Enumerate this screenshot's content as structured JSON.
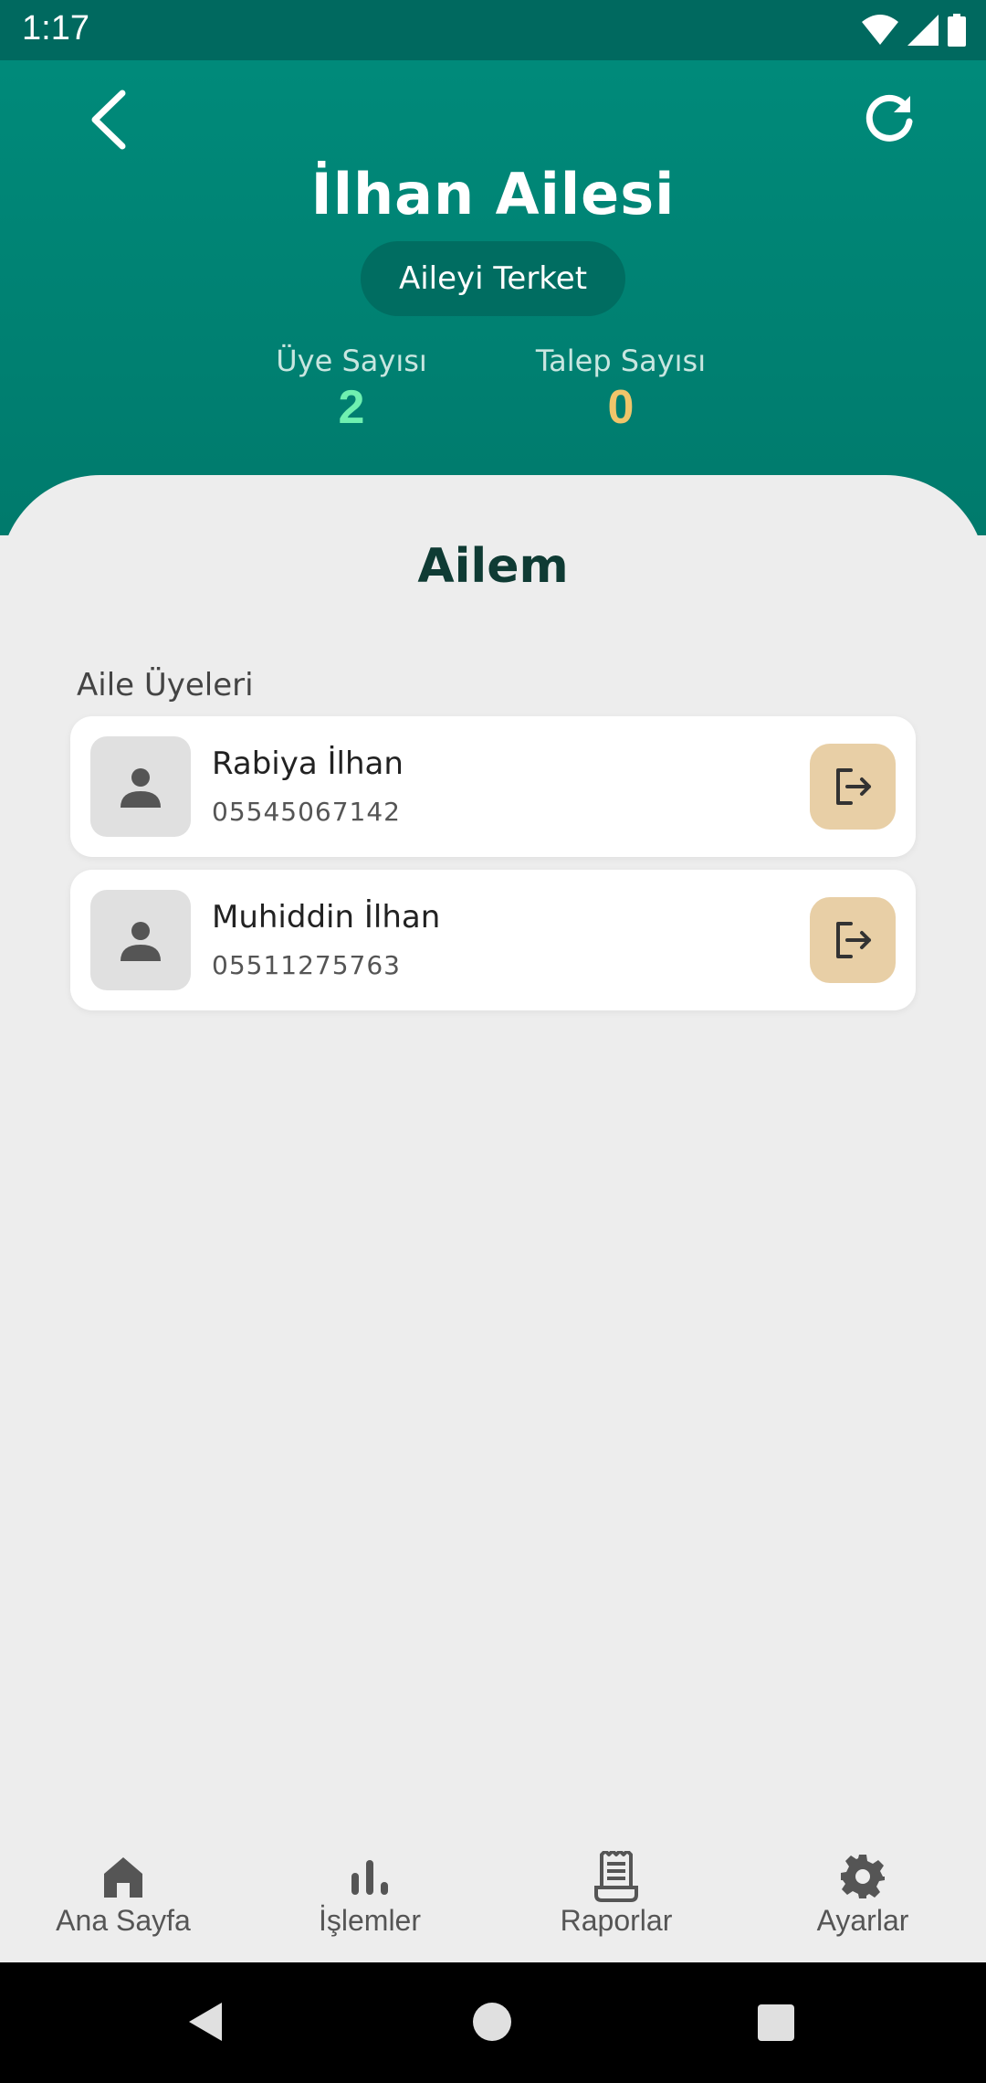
{
  "status_bar": {
    "time": "1:17"
  },
  "header": {
    "title": "İlhan Ailesi",
    "leave_family_label": "Aileyi Terket",
    "stats": {
      "members_label": "Üye Sayısı",
      "members_value": "2",
      "requests_label": "Talep Sayısı",
      "requests_value": "0"
    }
  },
  "main": {
    "section_title": "Ailem",
    "members_label": "Aile Üyeleri",
    "members": [
      {
        "name": "Rabiya İlhan",
        "phone": "05545067142"
      },
      {
        "name": "Muhiddin İlhan",
        "phone": "05511275763"
      }
    ]
  },
  "bottom_nav": {
    "items": [
      {
        "label": "Ana Sayfa",
        "icon": "home-icon"
      },
      {
        "label": "İşlemler",
        "icon": "bar-chart-icon"
      },
      {
        "label": "Raporlar",
        "icon": "receipt-icon"
      },
      {
        "label": "Ayarlar",
        "icon": "gear-icon"
      }
    ]
  },
  "colors": {
    "header_bg": "#008a7a",
    "member_count": "#6ff0b0",
    "request_count": "#f0c56a",
    "remove_button": "#e8cfa6",
    "title_text": "#0f3b34"
  }
}
